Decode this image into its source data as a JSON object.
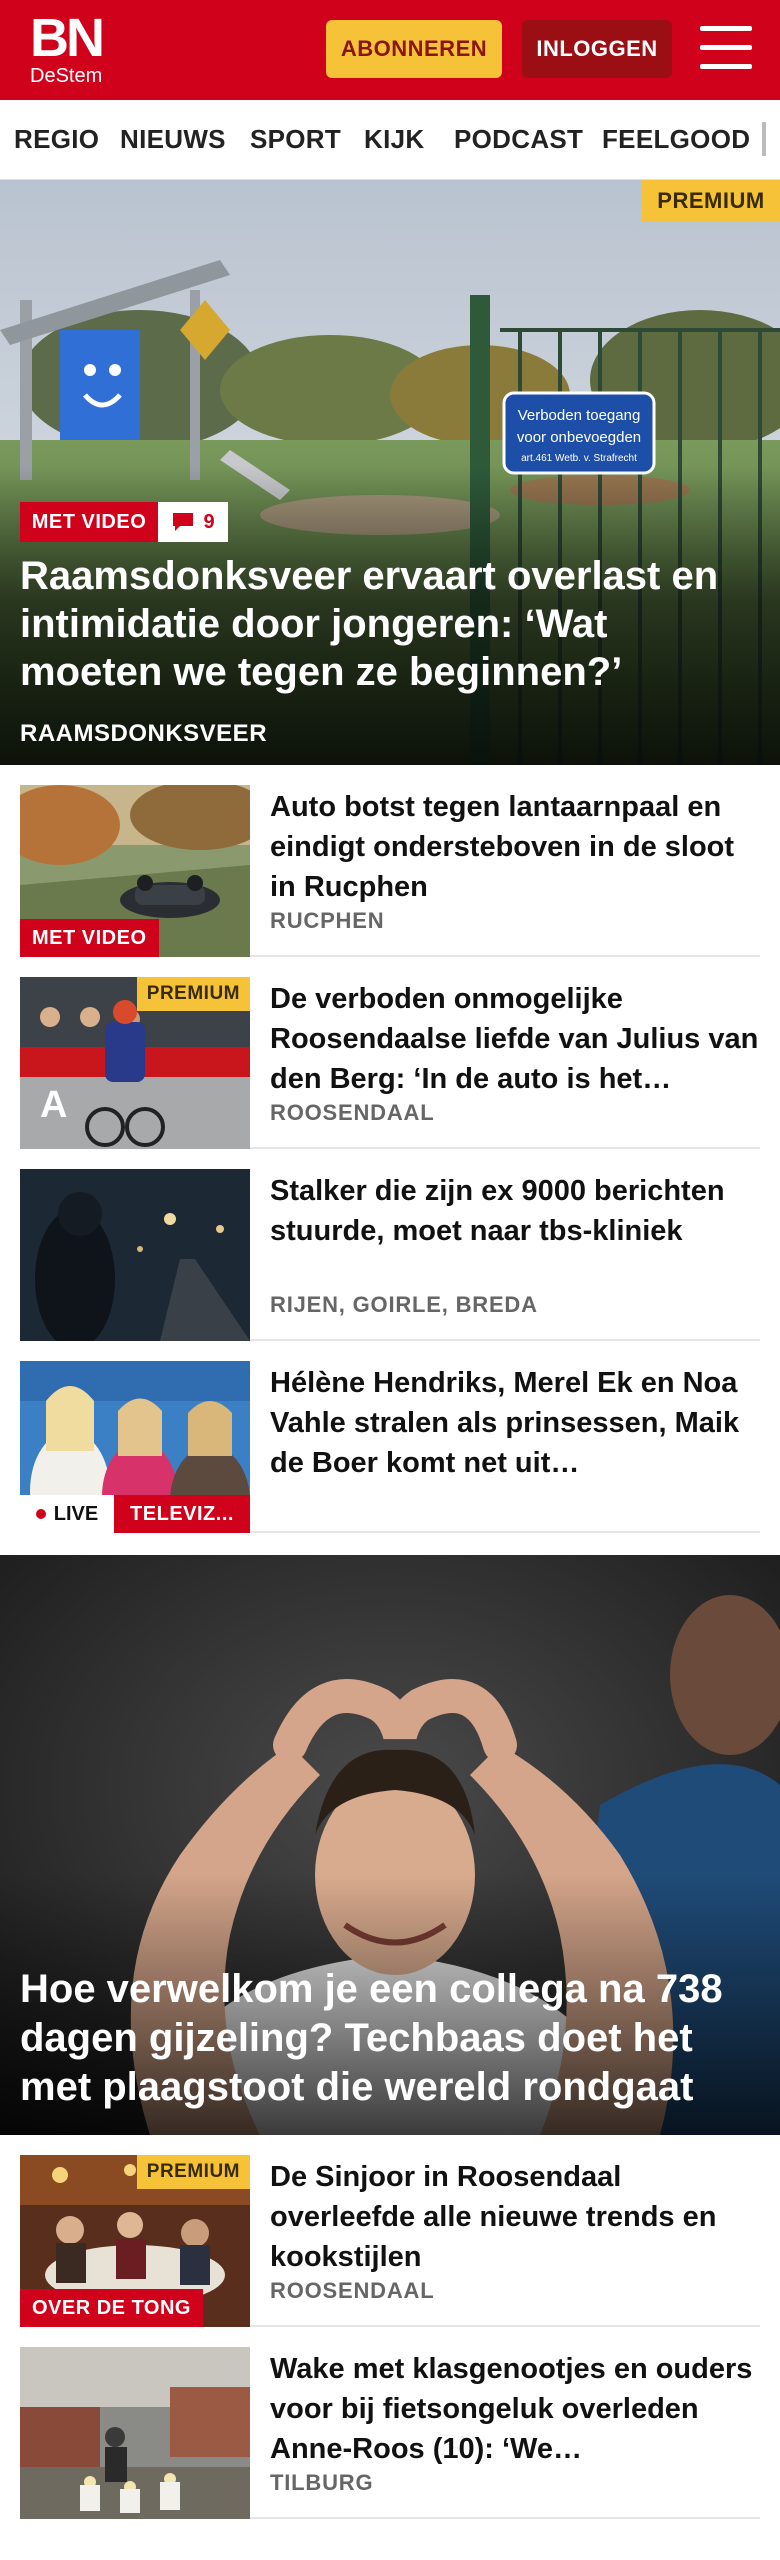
{
  "header": {
    "logo_main": "BN",
    "logo_sub": "DeStem",
    "subscribe_label": "ABONNEREN",
    "login_label": "INLOGGEN",
    "brand_color": "#d0021b",
    "accent_color": "#f6c338"
  },
  "nav": {
    "items": [
      "REGIO",
      "NIEUWS",
      "SPORT",
      "KIJK",
      "PODCAST",
      "FEELGOOD"
    ]
  },
  "hero": {
    "premium_label": "PREMIUM",
    "video_label": "MET VIDEO",
    "comment_count": "9",
    "title": "Raamsdonksveer ervaart overlast en intimidatie door jongeren: ‘Wat moeten we tegen ze beginnen?’",
    "location": "RAAMSDONKSVEER",
    "sign_text_1": "Verboden toegang",
    "sign_text_2": "voor onbevoegden",
    "sign_text_3": "art.461 Wetb. v. Strafrecht"
  },
  "articles": [
    {
      "title": "Auto botst tegen lantaarnpaal en eindigt ondersteboven in de sloot in Rucphen",
      "location": "RUCPHEN",
      "badge": "MET VIDEO"
    },
    {
      "title": "De verboden onmogelijke Roosendaalse liefde van Julius van den Berg: ‘In de auto is het…",
      "location": "ROOSENDAAL",
      "premium": "PREMIUM"
    },
    {
      "title": "Stalker die zijn ex 9000 berichten stuurde, moet naar tbs-kliniek",
      "location": "RIJEN, GOIRLE, BREDA"
    },
    {
      "title": "Hélène Hendriks, Merel Ek en Noa Vahle stralen als prinsessen, Maik de Boer komt net uit…",
      "live": "LIVE",
      "category": "TELEVIZ..."
    }
  ],
  "hero2": {
    "title": "Hoe verwelkom je een collega na 738 dagen gijzeling? Techbaas doet het met plaagstoot die wereld rondgaat"
  },
  "articles2": [
    {
      "title": "De Sinjoor in Roosendaal overleefde alle nieuwe trends en kookstijlen",
      "location": "ROOSENDAAL",
      "premium": "PREMIUM",
      "badge": "OVER DE TONG"
    },
    {
      "title": "Wake met klasgenootjes en ouders voor bij fietsongeluk overleden Anne-Roos (10): ‘We…",
      "location": "TILBURG"
    }
  ]
}
